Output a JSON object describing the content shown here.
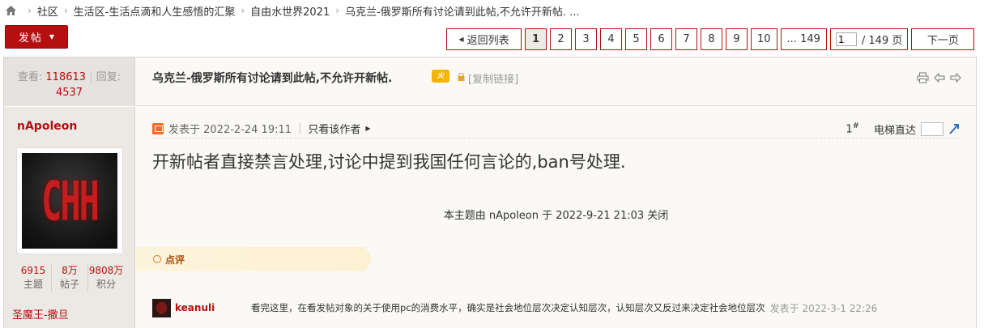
{
  "breadcrumb": {
    "items": [
      "社区",
      "生活区-生活点滴和人生感悟的汇聚",
      "自由水世界2021",
      "乌克兰-俄罗斯所有讨论请到此帖,不允许开新帖. ..."
    ]
  },
  "toolbar": {
    "post_label": "发帖"
  },
  "pager": {
    "back_label": "返回列表",
    "pages": [
      "1",
      "2",
      "3",
      "4",
      "5",
      "6",
      "7",
      "8",
      "9",
      "10",
      "... 149"
    ],
    "current": "1",
    "jump_value": "1",
    "total_label": "/ 149 页",
    "next_label": "下一页"
  },
  "thread": {
    "views_label": "查看:",
    "views": "118613",
    "replies_label": "回复:",
    "replies": "4537",
    "title": "乌克兰-俄罗斯所有讨论请到此帖,不允许开新帖.",
    "hot_badge": "火",
    "copy_link": "[复制链接]"
  },
  "author": {
    "name": "nApoleon",
    "avatar_text": "CHH",
    "stats": [
      {
        "value": "6915",
        "label": "主题"
      },
      {
        "value": "8万",
        "label": "帖子"
      },
      {
        "value": "9808万",
        "label": "积分"
      }
    ],
    "rank": "圣魔王-撒旦"
  },
  "post": {
    "posted_at": "发表于 2022-2-24 19:11",
    "only_author": "只看该作者",
    "floor": "1",
    "floor_mark": "#",
    "elevator_label": "电梯直达",
    "content": "开新帖者直接禁言处理,讨论中提到我国任何言论的,ban号处理.",
    "closed_note": "本主题由 nApoleon 于 2022-9-21 21:03 关闭",
    "review_label": "点评"
  },
  "comment": {
    "user": "keanuli",
    "text": "看完这里，在看发帖对象的关于使用pc的消费水平，确实是社会地位层次决定认知层次，认知层次又反过来决定社会地位层次",
    "time": "发表于 2022-3-1 22:26"
  }
}
